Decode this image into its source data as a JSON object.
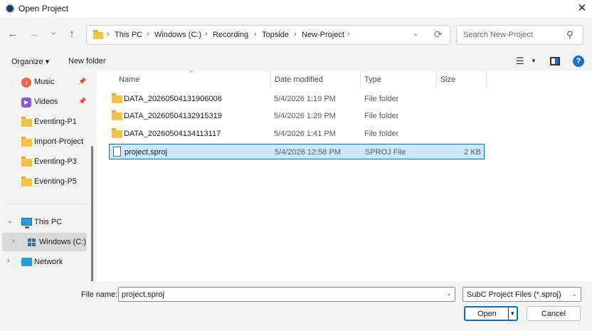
{
  "window": {
    "title": "Open Project",
    "close_glyph": "✕"
  },
  "nav": {
    "back": "←",
    "forward": "→",
    "recent": "⌄",
    "up": "↑",
    "breadcrumbs": [
      "This PC",
      "Windows (C:)",
      "Recording",
      "Topside",
      "New-Project"
    ],
    "separator": "›",
    "dropdown_glyph": "⌄",
    "refresh_glyph": "⟳",
    "search_placeholder": "Search New-Project",
    "search_glyph": "⚲"
  },
  "toolbar": {
    "organize_label": "Organize ▾",
    "new_folder_label": "New folder",
    "view_glyph": "☰",
    "view_dropdown": "▼",
    "help_glyph": "?"
  },
  "sidebar": {
    "items": [
      {
        "label": "Music",
        "icon": "music-icon",
        "pinned": true
      },
      {
        "label": "Videos",
        "icon": "videos-icon",
        "pinned": true
      },
      {
        "label": "Eventing-P1",
        "icon": "folder-icon"
      },
      {
        "label": "Import-Project",
        "icon": "folder-icon"
      },
      {
        "label": "Eventing-P3",
        "icon": "folder-icon"
      },
      {
        "label": "Eventing-P5",
        "icon": "folder-icon"
      },
      {
        "label": "This PC",
        "icon": "pc-icon",
        "expanded": true
      },
      {
        "label": "Windows (C:)",
        "icon": "drive-icon",
        "selected": true
      },
      {
        "label": "Network",
        "icon": "network-icon"
      }
    ],
    "pin_glyph": "📌",
    "expanded_glyph": "⌄",
    "collapsed_glyph": "›"
  },
  "file_list": {
    "columns": [
      "Name",
      "Date modified",
      "Type",
      "Size"
    ],
    "sort_caret": "^",
    "rows": [
      {
        "name": "DATA_20260504131906006",
        "date": "5/4/2026 1:19 PM",
        "type": "File folder",
        "size": "",
        "kind": "folder"
      },
      {
        "name": "DATA_20260504132915319",
        "date": "5/4/2026 1:29 PM",
        "type": "File folder",
        "size": "",
        "kind": "folder"
      },
      {
        "name": "DATA_20260504134113117",
        "date": "5/4/2026 1:41 PM",
        "type": "File folder",
        "size": "",
        "kind": "folder"
      },
      {
        "name": "project.sproj",
        "date": "5/4/2026 12:58 PM",
        "type": "SPROJ File",
        "size": "2 KB",
        "kind": "file",
        "selected": true
      }
    ]
  },
  "footer": {
    "file_name_label": "File name:",
    "file_name_value": "project.sproj",
    "filter_value": "SubC Project Files (*.sproj)",
    "dropdown_glyph": "⌄",
    "open_label": "Open",
    "open_dropdown": "▾",
    "cancel_label": "Cancel"
  },
  "colors": {
    "accent": "#0f6cbd",
    "selection": "#cce8ff",
    "folder": "#f2c347"
  }
}
